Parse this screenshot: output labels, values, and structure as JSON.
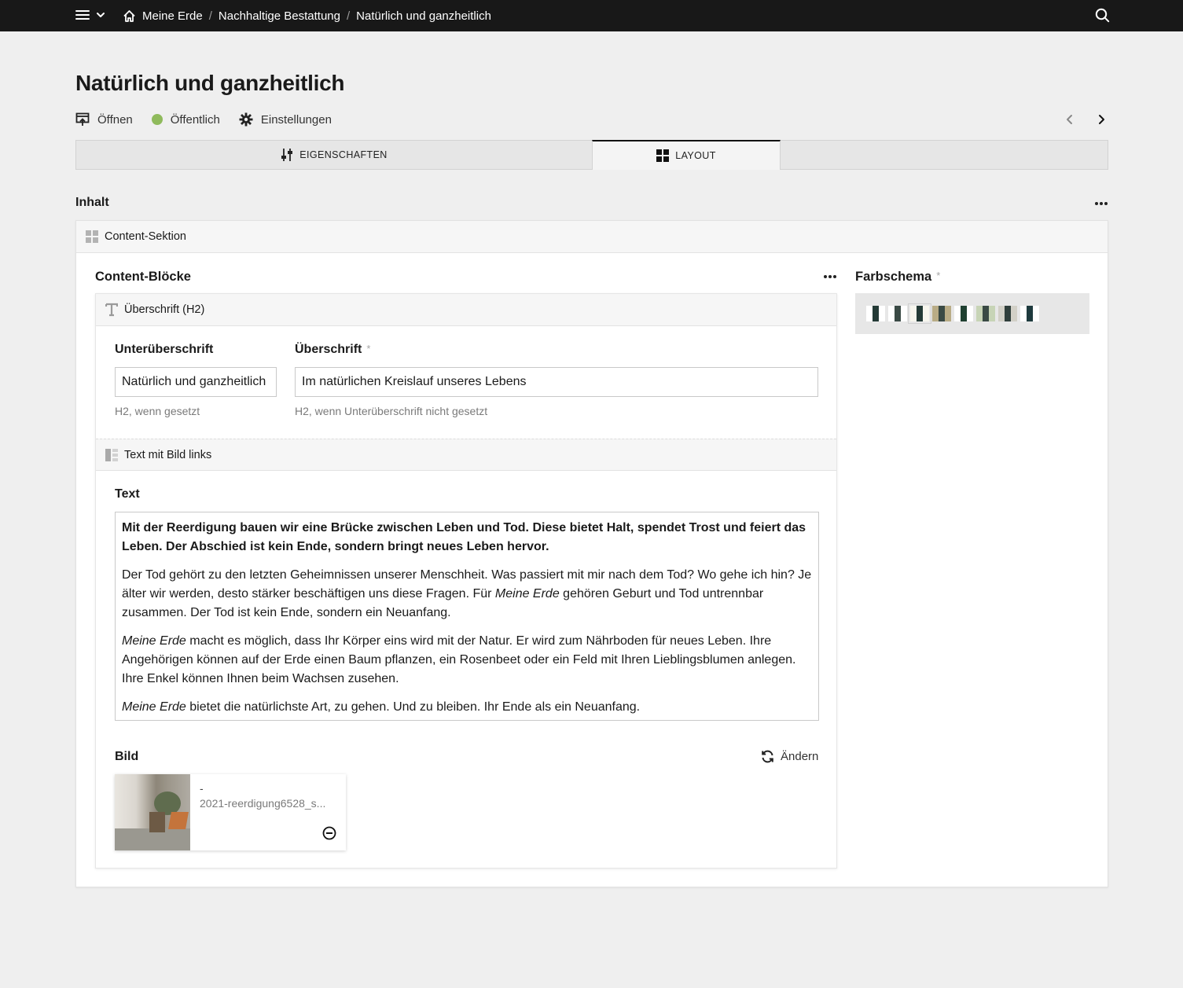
{
  "breadcrumbs": [
    "Meine Erde",
    "Nachhaltige Bestattung",
    "Natürlich und ganzheitlich"
  ],
  "page_title": "Natürlich und ganzheitlich",
  "actions": {
    "open_label": "Öffnen",
    "status_label": "Öffentlich",
    "status_color": "#8fba5c",
    "settings_label": "Einstellungen"
  },
  "tabs": [
    {
      "label": "EIGENSCHAFTEN",
      "icon": "sliders-icon"
    },
    {
      "label": "LAYOUT",
      "icon": "grid-icon",
      "active": true
    }
  ],
  "content": {
    "label": "Inhalt",
    "section_type": "Content-Sektion",
    "blocks_title": "Content-Blöcke",
    "color_scheme": {
      "title": "Farbschema",
      "required_mark": "*",
      "options": [
        {
          "a": "#ffffff",
          "b": "#243a36"
        },
        {
          "a": "#ffffff",
          "b": "#3a4a45"
        },
        {
          "a": "#f7f6ee",
          "b": "#243a36",
          "selected": true
        },
        {
          "a": "#b9ac86",
          "b": "#3a4a45"
        },
        {
          "a": "#ffffff",
          "b": "#1f4031"
        },
        {
          "a": "#c7d4b6",
          "b": "#3a4a45"
        },
        {
          "a": "#d2d0c7",
          "b": "#2f3e3b"
        },
        {
          "a": "#ffffff",
          "b": "#1e3a3e"
        }
      ]
    },
    "heading_block": {
      "type_label": "Überschrift (H2)",
      "subheading_label": "Unterüberschrift",
      "subheading_value": "Natürlich und ganzheitlich",
      "subheading_hint": "H2, wenn gesetzt",
      "heading_label": "Überschrift",
      "heading_required": "*",
      "heading_value": "Im natürlichen Kreislauf unseres Lebens",
      "heading_hint": "H2, wenn Unterüberschrift nicht gesetzt"
    },
    "text_block": {
      "type_label": "Text mit Bild links",
      "text_label": "Text",
      "paragraphs": {
        "lead": "Mit der Reerdigung bauen wir eine Brücke zwischen Leben und Tod. Diese bietet Halt, spendet Trost und feiert das Leben. Der Abschied ist kein Ende, sondern bringt neues Leben hervor.",
        "p2_a": "Der Tod gehört zu den letzten Geheimnissen unserer Menschheit. Was passiert mit mir nach dem Tod? Wo gehe ich hin? Je älter wir werden, desto stärker beschäftigen uns diese Fragen. Für ",
        "p2_em": "Meine Erde",
        "p2_b": " gehören Geburt und Tod untrennbar zusammen. Der Tod ist kein Ende, sondern ein Neuanfang.",
        "p3_em": "Meine Erde",
        "p3_b": " macht es möglich, dass Ihr Körper eins wird mit der Natur. Er wird zum Nährboden für neues Leben. Ihre Angehörigen können auf der Erde einen Baum pflanzen, ein Rosenbeet oder ein Feld mit Ihren Lieblingsblumen anlegen. Ihre Enkel können Ihnen beim Wachsen zusehen.",
        "p4_em": "Meine Erde",
        "p4_b": " bietet die natürlichste Art, zu gehen. Und zu bleiben. Ihr Ende als ein Neuanfang."
      },
      "image_label": "Bild",
      "change_label": "Ändern",
      "image_dash": "-",
      "image_filename": "2021-reerdigung6528_s..."
    }
  }
}
